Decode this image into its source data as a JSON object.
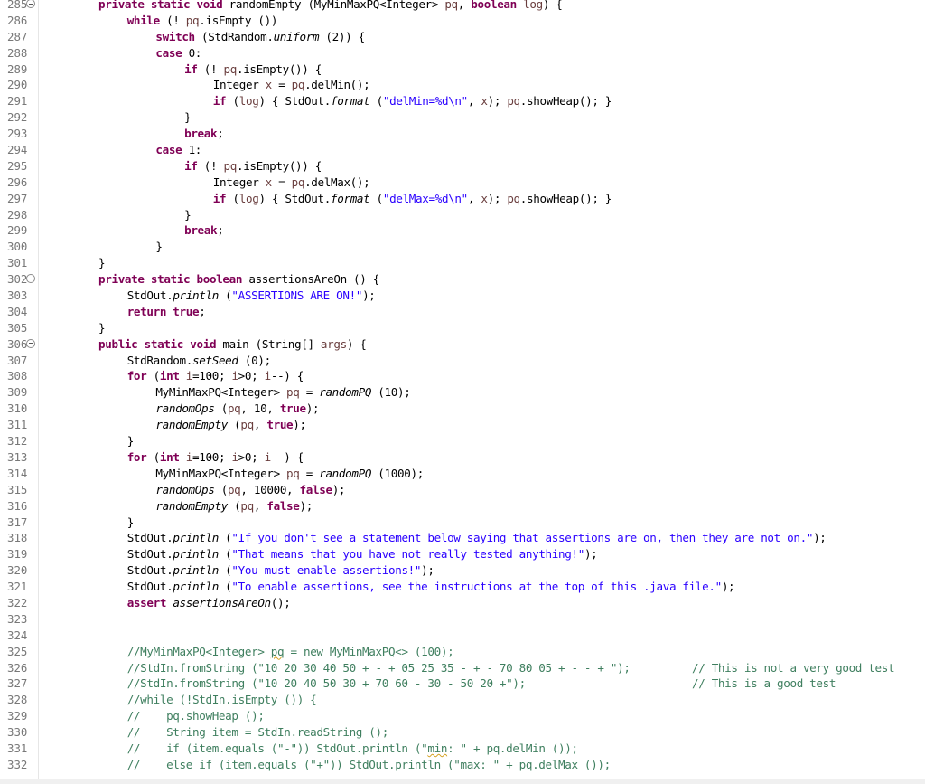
{
  "editor": {
    "language": "java",
    "first_line_number": 285,
    "lines": [
      {
        "n": "285",
        "fold": true,
        "indent": 0,
        "segments": [
          [
            "kw",
            "private static void "
          ],
          [
            "",
            "randomEmpty (MyMinMaxPQ<Integer> "
          ],
          [
            "var",
            "pq"
          ],
          [
            "",
            ", "
          ],
          [
            "kw",
            "boolean "
          ],
          [
            "var",
            "log"
          ],
          [
            "",
            ") {"
          ]
        ]
      },
      {
        "n": "286",
        "fold": false,
        "indent": 1,
        "segments": [
          [
            "kw",
            "while "
          ],
          [
            "",
            "(! "
          ],
          [
            "var",
            "pq"
          ],
          [
            "",
            ".isEmpty ())"
          ]
        ]
      },
      {
        "n": "287",
        "fold": false,
        "indent": 2,
        "segments": [
          [
            "kw",
            "switch "
          ],
          [
            "",
            "(StdRandom."
          ],
          [
            "it",
            "uniform"
          ],
          [
            "",
            " (2)) {"
          ]
        ]
      },
      {
        "n": "288",
        "fold": false,
        "indent": 2,
        "segments": [
          [
            "kw",
            "case "
          ],
          [
            "",
            "0:"
          ]
        ]
      },
      {
        "n": "289",
        "fold": false,
        "indent": 3,
        "segments": [
          [
            "kw",
            "if "
          ],
          [
            "",
            "(! "
          ],
          [
            "var",
            "pq"
          ],
          [
            "",
            ".isEmpty()) {"
          ]
        ]
      },
      {
        "n": "290",
        "fold": false,
        "indent": 4,
        "segments": [
          [
            "",
            "Integer "
          ],
          [
            "var",
            "x"
          ],
          [
            "",
            " = "
          ],
          [
            "var",
            "pq"
          ],
          [
            "",
            ".delMin();"
          ]
        ]
      },
      {
        "n": "291",
        "fold": false,
        "indent": 4,
        "segments": [
          [
            "kw",
            "if "
          ],
          [
            "",
            "("
          ],
          [
            "var",
            "log"
          ],
          [
            "",
            ") { StdOut."
          ],
          [
            "it",
            "format"
          ],
          [
            "",
            " ("
          ],
          [
            "str",
            "\"delMin=%d\\n\""
          ],
          [
            "",
            ", "
          ],
          [
            "var",
            "x"
          ],
          [
            "",
            "); "
          ],
          [
            "var",
            "pq"
          ],
          [
            "",
            ".showHeap(); }"
          ]
        ]
      },
      {
        "n": "292",
        "fold": false,
        "indent": 3,
        "segments": [
          [
            "",
            "}"
          ]
        ]
      },
      {
        "n": "293",
        "fold": false,
        "indent": 3,
        "segments": [
          [
            "kw",
            "break"
          ],
          [
            "",
            ";"
          ]
        ]
      },
      {
        "n": "294",
        "fold": false,
        "indent": 2,
        "segments": [
          [
            "kw",
            "case "
          ],
          [
            "",
            "1:"
          ]
        ]
      },
      {
        "n": "295",
        "fold": false,
        "indent": 3,
        "segments": [
          [
            "kw",
            "if "
          ],
          [
            "",
            "(! "
          ],
          [
            "var",
            "pq"
          ],
          [
            "",
            ".isEmpty()) {"
          ]
        ]
      },
      {
        "n": "296",
        "fold": false,
        "indent": 4,
        "segments": [
          [
            "",
            "Integer "
          ],
          [
            "var",
            "x"
          ],
          [
            "",
            " = "
          ],
          [
            "var",
            "pq"
          ],
          [
            "",
            ".delMax();"
          ]
        ]
      },
      {
        "n": "297",
        "fold": false,
        "indent": 4,
        "segments": [
          [
            "kw",
            "if "
          ],
          [
            "",
            "("
          ],
          [
            "var",
            "log"
          ],
          [
            "",
            ") { StdOut."
          ],
          [
            "it",
            "format"
          ],
          [
            "",
            " ("
          ],
          [
            "str",
            "\"delMax=%d\\n\""
          ],
          [
            "",
            ", "
          ],
          [
            "var",
            "x"
          ],
          [
            "",
            "); "
          ],
          [
            "var",
            "pq"
          ],
          [
            "",
            ".showHeap(); }"
          ]
        ]
      },
      {
        "n": "298",
        "fold": false,
        "indent": 3,
        "segments": [
          [
            "",
            "}"
          ]
        ]
      },
      {
        "n": "299",
        "fold": false,
        "indent": 3,
        "segments": [
          [
            "kw",
            "break"
          ],
          [
            "",
            ";"
          ]
        ]
      },
      {
        "n": "300",
        "fold": false,
        "indent": 2,
        "segments": [
          [
            "",
            "}"
          ]
        ]
      },
      {
        "n": "301",
        "fold": false,
        "indent": 0,
        "segments": [
          [
            "",
            "}"
          ]
        ]
      },
      {
        "n": "302",
        "fold": true,
        "indent": 0,
        "segments": [
          [
            "kw",
            "private static boolean "
          ],
          [
            "",
            "assertionsAreOn () {"
          ]
        ]
      },
      {
        "n": "303",
        "fold": false,
        "indent": 1,
        "segments": [
          [
            "",
            "StdOut."
          ],
          [
            "it",
            "println"
          ],
          [
            "",
            " ("
          ],
          [
            "str",
            "\"ASSERTIONS ARE ON!\""
          ],
          [
            "",
            ");"
          ]
        ]
      },
      {
        "n": "304",
        "fold": false,
        "indent": 1,
        "segments": [
          [
            "kw",
            "return true"
          ],
          [
            "",
            ";"
          ]
        ]
      },
      {
        "n": "305",
        "fold": false,
        "indent": 0,
        "segments": [
          [
            "",
            "}"
          ]
        ]
      },
      {
        "n": "306",
        "fold": true,
        "indent": 0,
        "segments": [
          [
            "kw",
            "public static void "
          ],
          [
            "",
            "main (String[] "
          ],
          [
            "var",
            "args"
          ],
          [
            "",
            ") {"
          ]
        ]
      },
      {
        "n": "307",
        "fold": false,
        "indent": 1,
        "segments": [
          [
            "",
            "StdRandom."
          ],
          [
            "it",
            "setSeed"
          ],
          [
            "",
            " (0);"
          ]
        ]
      },
      {
        "n": "308",
        "fold": false,
        "indent": 1,
        "segments": [
          [
            "kw",
            "for "
          ],
          [
            "",
            "("
          ],
          [
            "kw",
            "int "
          ],
          [
            "var",
            "i"
          ],
          [
            "",
            "=100; "
          ],
          [
            "var",
            "i"
          ],
          [
            "",
            ">0; "
          ],
          [
            "var",
            "i"
          ],
          [
            "",
            "--) {"
          ]
        ]
      },
      {
        "n": "309",
        "fold": false,
        "indent": 2,
        "segments": [
          [
            "",
            "MyMinMaxPQ<Integer> "
          ],
          [
            "var",
            "pq"
          ],
          [
            "",
            " = "
          ],
          [
            "it",
            "randomPQ"
          ],
          [
            "",
            " (10);"
          ]
        ]
      },
      {
        "n": "310",
        "fold": false,
        "indent": 2,
        "segments": [
          [
            "it",
            "randomOps"
          ],
          [
            "",
            " ("
          ],
          [
            "var",
            "pq"
          ],
          [
            "",
            ", 10, "
          ],
          [
            "kw",
            "true"
          ],
          [
            "",
            ");"
          ]
        ]
      },
      {
        "n": "311",
        "fold": false,
        "indent": 2,
        "segments": [
          [
            "it",
            "randomEmpty"
          ],
          [
            "",
            " ("
          ],
          [
            "var",
            "pq"
          ],
          [
            "",
            ", "
          ],
          [
            "kw",
            "true"
          ],
          [
            "",
            ");"
          ]
        ]
      },
      {
        "n": "312",
        "fold": false,
        "indent": 1,
        "segments": [
          [
            "",
            "}"
          ]
        ]
      },
      {
        "n": "313",
        "fold": false,
        "indent": 1,
        "segments": [
          [
            "kw",
            "for "
          ],
          [
            "",
            "("
          ],
          [
            "kw",
            "int "
          ],
          [
            "var",
            "i"
          ],
          [
            "",
            "=100; "
          ],
          [
            "var",
            "i"
          ],
          [
            "",
            ">0; "
          ],
          [
            "var",
            "i"
          ],
          [
            "",
            "--) {"
          ]
        ]
      },
      {
        "n": "314",
        "fold": false,
        "indent": 2,
        "segments": [
          [
            "",
            "MyMinMaxPQ<Integer> "
          ],
          [
            "var",
            "pq"
          ],
          [
            "",
            " = "
          ],
          [
            "it",
            "randomPQ"
          ],
          [
            "",
            " (1000);"
          ]
        ]
      },
      {
        "n": "315",
        "fold": false,
        "indent": 2,
        "segments": [
          [
            "it",
            "randomOps"
          ],
          [
            "",
            " ("
          ],
          [
            "var",
            "pq"
          ],
          [
            "",
            ", 10000, "
          ],
          [
            "kw",
            "false"
          ],
          [
            "",
            ");"
          ]
        ]
      },
      {
        "n": "316",
        "fold": false,
        "indent": 2,
        "segments": [
          [
            "it",
            "randomEmpty"
          ],
          [
            "",
            " ("
          ],
          [
            "var",
            "pq"
          ],
          [
            "",
            ", "
          ],
          [
            "kw",
            "false"
          ],
          [
            "",
            ");"
          ]
        ]
      },
      {
        "n": "317",
        "fold": false,
        "indent": 1,
        "segments": [
          [
            "",
            "}"
          ]
        ]
      },
      {
        "n": "318",
        "fold": false,
        "indent": 1,
        "segments": [
          [
            "",
            "StdOut."
          ],
          [
            "it",
            "println"
          ],
          [
            "",
            " ("
          ],
          [
            "str",
            "\"If you don't see a statement below saying that assertions are on, then they are not on.\""
          ],
          [
            "",
            ");"
          ]
        ]
      },
      {
        "n": "319",
        "fold": false,
        "indent": 1,
        "segments": [
          [
            "",
            "StdOut."
          ],
          [
            "it",
            "println"
          ],
          [
            "",
            " ("
          ],
          [
            "str",
            "\"That means that you have not really tested anything!\""
          ],
          [
            "",
            ");"
          ]
        ]
      },
      {
        "n": "320",
        "fold": false,
        "indent": 1,
        "segments": [
          [
            "",
            "StdOut."
          ],
          [
            "it",
            "println"
          ],
          [
            "",
            " ("
          ],
          [
            "str",
            "\"You must enable assertions!\""
          ],
          [
            "",
            ");"
          ]
        ]
      },
      {
        "n": "321",
        "fold": false,
        "indent": 1,
        "segments": [
          [
            "",
            "StdOut."
          ],
          [
            "it",
            "println"
          ],
          [
            "",
            " ("
          ],
          [
            "str",
            "\"To enable assertions, see the instructions at the top of this .java file.\""
          ],
          [
            "",
            ");"
          ]
        ]
      },
      {
        "n": "322",
        "fold": false,
        "indent": 1,
        "segments": [
          [
            "kw",
            "assert "
          ],
          [
            "it",
            "assertionsAreOn"
          ],
          [
            "",
            "();"
          ]
        ]
      },
      {
        "n": "323",
        "fold": false,
        "indent": 0,
        "segments": []
      },
      {
        "n": "324",
        "fold": false,
        "indent": 0,
        "segments": []
      },
      {
        "n": "325",
        "fold": false,
        "indent": 1,
        "segments": [
          [
            "cm",
            "//MyMinMaxPQ<Integer> "
          ],
          [
            "cm sq",
            "pq"
          ],
          [
            "cm",
            " = new MyMinMaxPQ<> (100);"
          ]
        ]
      },
      {
        "n": "326",
        "fold": false,
        "indent": 1,
        "segments": [
          [
            "cm",
            "//StdIn.fromString (\"10 20 30 40 50 + - + 05 25 35 - + - 70 80 05 + - - + \");"
          ]
        ],
        "right_comment": "// This is not a very good test"
      },
      {
        "n": "327",
        "fold": false,
        "indent": 1,
        "segments": [
          [
            "cm",
            "//StdIn.fromString (\"10 20 40 50 30 + 70 60 - 30 - 50 20 +\");"
          ]
        ],
        "right_comment": "// This is a good test"
      },
      {
        "n": "328",
        "fold": false,
        "indent": 1,
        "segments": [
          [
            "cm",
            "//while (!StdIn.isEmpty ()) {"
          ]
        ]
      },
      {
        "n": "329",
        "fold": false,
        "indent": 1,
        "segments": [
          [
            "cm",
            "//    pq.showHeap ();"
          ]
        ]
      },
      {
        "n": "330",
        "fold": false,
        "indent": 1,
        "segments": [
          [
            "cm",
            "//    String item = StdIn.readString ();"
          ]
        ]
      },
      {
        "n": "331",
        "fold": false,
        "indent": 1,
        "segments": [
          [
            "cm",
            "//    if (item.equals (\"-\")) StdOut.println (\""
          ],
          [
            "cm sq",
            "min"
          ],
          [
            "cm",
            ": \" + pq.delMin ());"
          ]
        ]
      },
      {
        "n": "332",
        "fold": false,
        "indent": 1,
        "segments": [
          [
            "cm",
            "//    else if (item.equals (\"+\")) StdOut.println (\"max: \" + pq.delMax ());"
          ]
        ]
      }
    ]
  }
}
